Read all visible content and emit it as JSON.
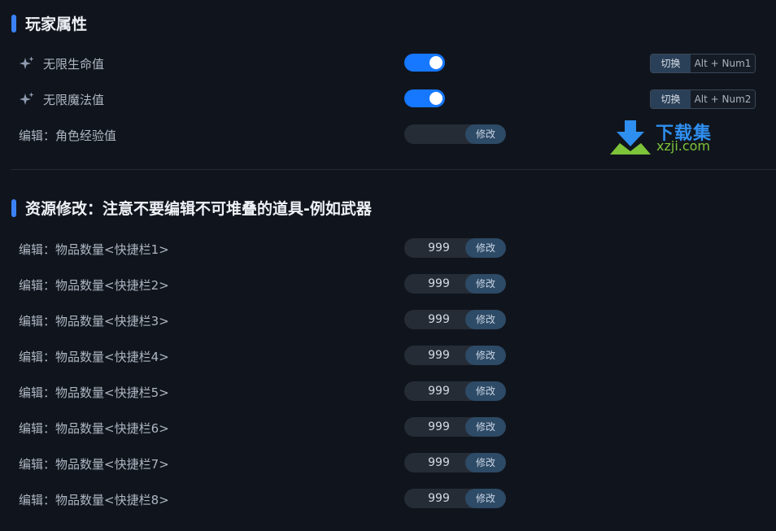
{
  "sections": [
    {
      "title": "玩家属性"
    },
    {
      "title": "资源修改：注意不要编辑不可堆叠的道具-例如武器"
    }
  ],
  "player": {
    "infinite_hp": {
      "label": "无限生命值",
      "toggle": true,
      "hotkey_label": "切换",
      "hotkey": "Alt + Num1"
    },
    "infinite_mp": {
      "label": "无限魔法值",
      "toggle": true,
      "hotkey_label": "切换",
      "hotkey": "Alt + Num2"
    },
    "exp": {
      "label": "编辑：角色经验值",
      "value": "",
      "button": "修改"
    }
  },
  "resources": [
    {
      "label": "编辑：物品数量<快捷栏1>",
      "value": "999",
      "button": "修改"
    },
    {
      "label": "编辑：物品数量<快捷栏2>",
      "value": "999",
      "button": "修改"
    },
    {
      "label": "编辑：物品数量<快捷栏3>",
      "value": "999",
      "button": "修改"
    },
    {
      "label": "编辑：物品数量<快捷栏4>",
      "value": "999",
      "button": "修改"
    },
    {
      "label": "编辑：物品数量<快捷栏5>",
      "value": "999",
      "button": "修改"
    },
    {
      "label": "编辑：物品数量<快捷栏6>",
      "value": "999",
      "button": "修改"
    },
    {
      "label": "编辑：物品数量<快捷栏7>",
      "value": "999",
      "button": "修改"
    },
    {
      "label": "编辑：物品数量<快捷栏8>",
      "value": "999",
      "button": "修改"
    }
  ],
  "watermark": {
    "cn": "下载集",
    "en": "xzji.com"
  },
  "icons": {
    "feature": "sparkle-icon",
    "watermark": "download-arrow-logo"
  },
  "colors": {
    "accent": "#3b82f6",
    "toggle_on": "#1677ff",
    "background": "#10151d"
  }
}
